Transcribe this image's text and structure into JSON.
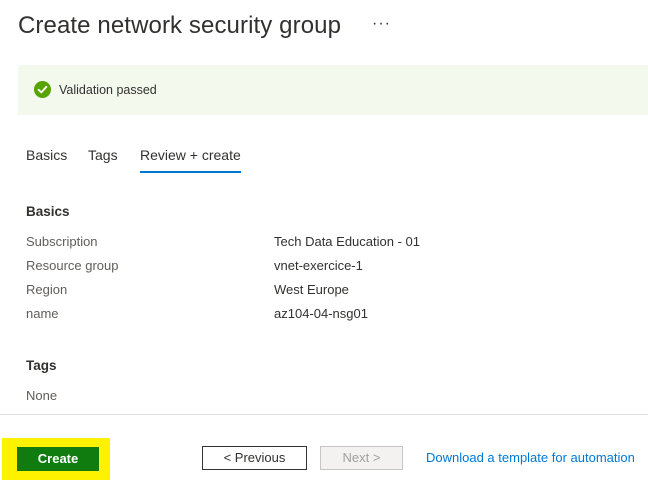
{
  "header": {
    "title": "Create network security group",
    "more_label": "···"
  },
  "banner": {
    "icon": "checkmark-circle-icon",
    "text": "Validation passed",
    "color": "#57a300"
  },
  "tabs": [
    {
      "label": "Basics"
    },
    {
      "label": "Tags"
    },
    {
      "label": "Review + create",
      "active": true
    }
  ],
  "basics": {
    "title": "Basics",
    "rows": [
      {
        "label": "Subscription",
        "value": "Tech Data Education - 01"
      },
      {
        "label": "Resource group",
        "value": "vnet-exercice-1"
      },
      {
        "label": "Region",
        "value": "West Europe"
      },
      {
        "label": "name",
        "value": "az104-04-nsg01"
      }
    ]
  },
  "tags": {
    "title": "Tags",
    "value": "None"
  },
  "footer": {
    "create_label": "Create",
    "previous_label": "< Previous",
    "next_label": "Next >",
    "download_link": "Download a template for automation"
  },
  "colors": {
    "accent": "#0078d4",
    "create_button": "#107c10",
    "highlight": "#fff200"
  }
}
